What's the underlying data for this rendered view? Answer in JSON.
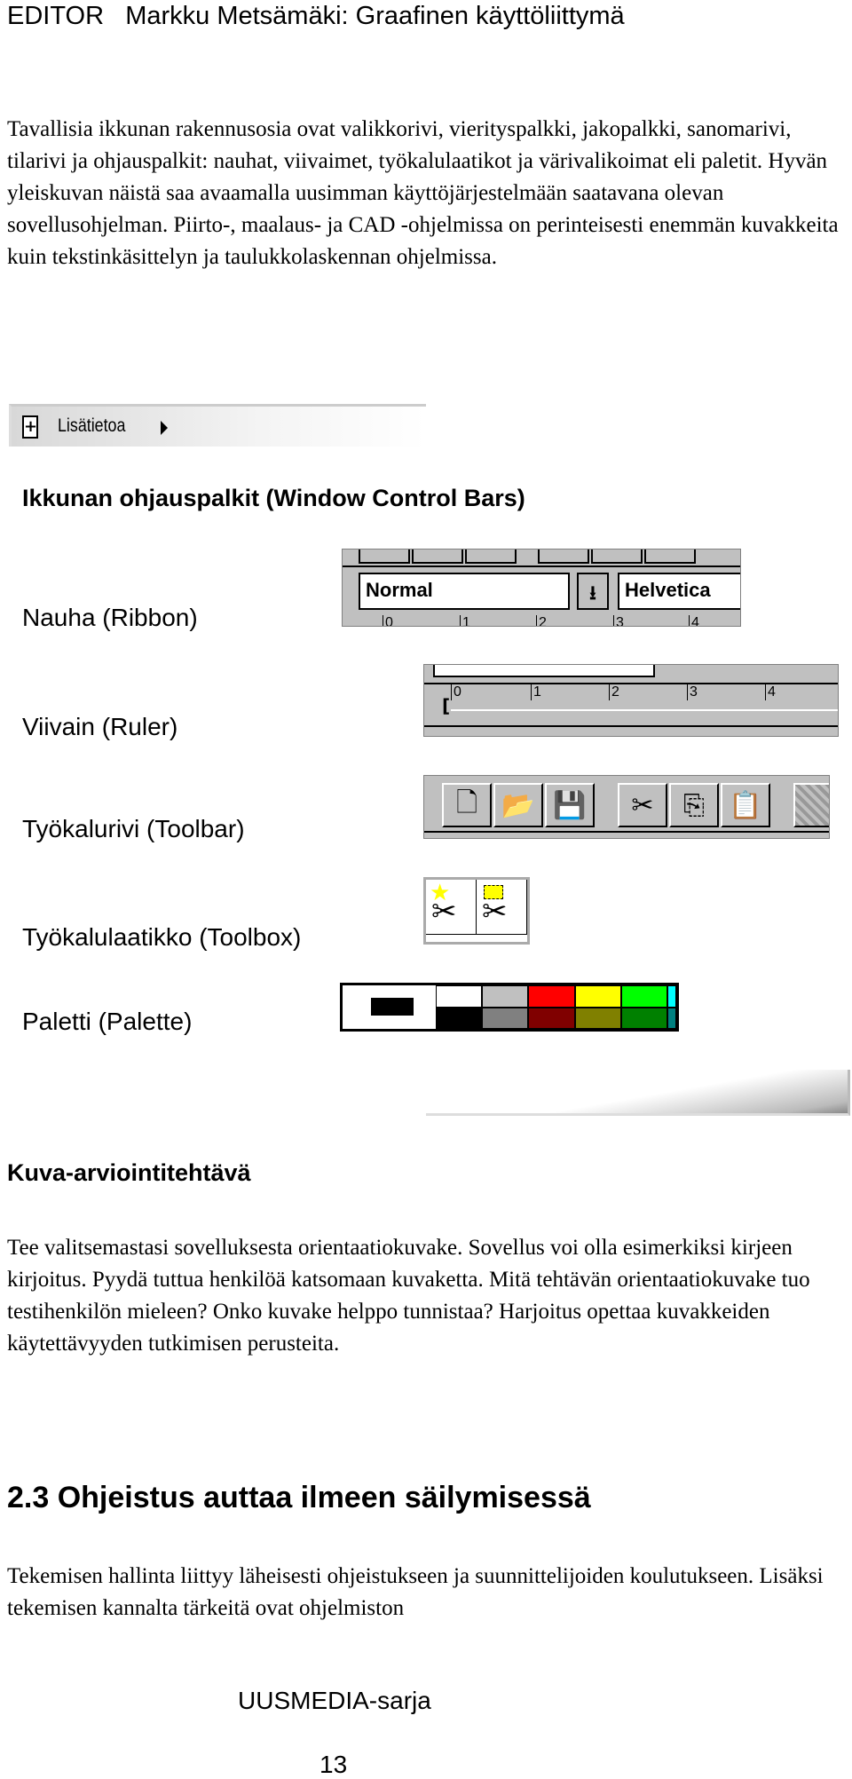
{
  "header": {
    "title": "EDITOR   Markku Metsämäki: Graafinen käyttöliittymä"
  },
  "intro": "Tavallisia ikkunan rakennusosia ovat valikkorivi, vierityspalkki, jakopalkki, sanomarivi, tilarivi ja ohjauspalkit: nauhat, viivaimet, työkalulaatikot ja värivalikoimat eli paletit. Hyvän yleiskuvan näistä saa avaamalla uusimman käyttöjärjestelmään saatavana olevan sovellusohjelman. Piirto-, maalaus- ja CAD -ohjelmissa on perinteisesti enemmän kuvakkeita kuin tekstinkäsittelyn ja taulukkolaskennan ohjelmissa.",
  "more_info": {
    "icon": "plus-document-icon",
    "label": "Lisätietoa"
  },
  "box": {
    "title": "Ikkunan ohjauspalkit (Window Control Bars)",
    "labels": [
      "Nauha (Ribbon)",
      "Viivain (Ruler)",
      "Työkalurivi (Toolbar)",
      "Työkalulaatikko (Toolbox)",
      "Paletti (Palette)"
    ],
    "ribbon": {
      "style": "Normal",
      "font": "Helvetica",
      "ticks": [
        "0",
        "1",
        "2",
        "3",
        "4"
      ]
    },
    "ruler": {
      "ticks": [
        "0",
        "1",
        "2",
        "3",
        "4"
      ]
    },
    "toolbar": {
      "icons": [
        "new-document-icon",
        "open-folder-icon",
        "save-disk-icon",
        "cut-scissors-icon",
        "copy-icon",
        "paste-icon",
        "format-painter-icon"
      ]
    },
    "toolbox": {
      "icons": [
        "free-select-scissors-icon",
        "rect-select-scissors-icon"
      ]
    },
    "palette": {
      "colors": [
        [
          "#ffffff",
          "#000000"
        ],
        [
          "#c0c0c0",
          "#808080"
        ],
        [
          "#ff0000",
          "#800000"
        ],
        [
          "#ffff00",
          "#808000"
        ],
        [
          "#00ff00",
          "#008000"
        ],
        [
          "#00ffff",
          "#008080"
        ]
      ]
    }
  },
  "task": {
    "title": "Kuva-arviointitehtävä",
    "text": "Tee valitsemastasi sovelluksesta orientaatiokuvake. Sovellus voi olla esimerkiksi kirjeen kirjoitus. Pyydä tuttua henkilöä katsomaan kuvaketta. Mitä tehtävän orientaatiokuvake tuo testihenkilön mieleen? Onko kuvake helppo tunnistaa? Harjoitus opettaa kuvakkeiden käytettävyyden tutkimisen perusteita."
  },
  "section": {
    "title": "2.3 Ohjeistus auttaa ilmeen säilymisessä",
    "text": "Tekemisen hallinta liittyy läheisesti ohjeistukseen ja suunnittelijoiden koulutukseen. Lisäksi tekemisen kannalta tärkeitä ovat ohjelmiston"
  },
  "footer": {
    "series": "UUSMEDIA-sarja",
    "page": "13"
  }
}
